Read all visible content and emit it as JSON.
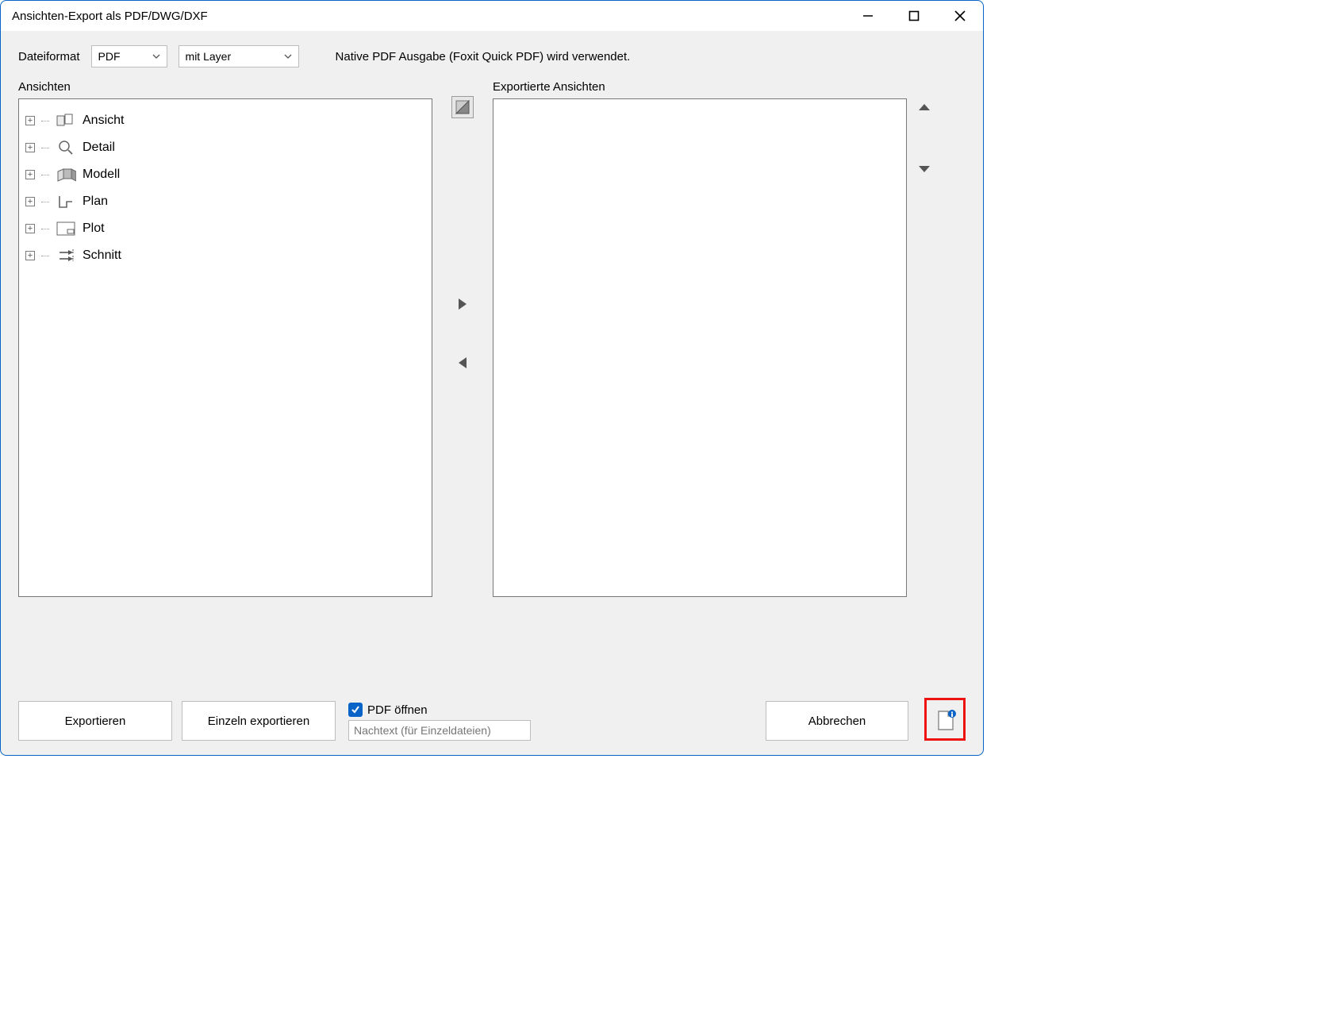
{
  "window": {
    "title": "Ansichten-Export als PDF/DWG/DXF"
  },
  "top": {
    "format_label": "Dateiformat",
    "format_value": "PDF",
    "layer_value": "mit Layer",
    "status": "Native PDF Ausgabe (Foxit Quick PDF) wird verwendet."
  },
  "lists": {
    "left_header": "Ansichten",
    "right_header": "Exportierte Ansichten",
    "tree": [
      {
        "label": "Ansicht"
      },
      {
        "label": "Detail"
      },
      {
        "label": "Modell"
      },
      {
        "label": "Plan"
      },
      {
        "label": "Plot"
      },
      {
        "label": "Schnitt"
      }
    ]
  },
  "footer": {
    "export_btn": "Exportieren",
    "single_export_btn": "Einzeln exportieren",
    "pdf_open_label": "PDF öffnen",
    "suffix_placeholder": "Nachtext (für Einzeldateien)",
    "cancel_btn": "Abbrechen"
  }
}
